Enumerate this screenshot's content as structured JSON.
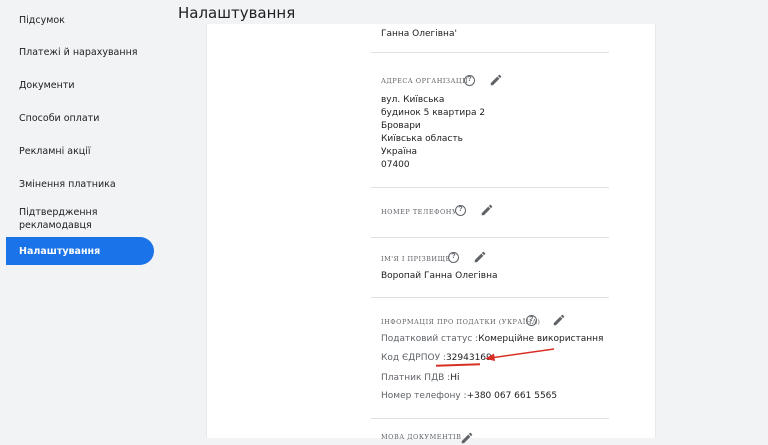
{
  "header": {
    "title": "Налаштування"
  },
  "sidebar": {
    "items": [
      {
        "label": "Підсумок"
      },
      {
        "label": "Платежі й нарахування"
      },
      {
        "label": "Документи"
      },
      {
        "label": "Способи оплати"
      },
      {
        "label": "Рекламні акції"
      },
      {
        "label": "Змінення платника"
      },
      {
        "label": "Підтвердження рекламодавця"
      },
      {
        "label": "Налаштування"
      }
    ],
    "active_index": 7
  },
  "settings": {
    "top_partial_name": "Ганна Олегівна'",
    "org_address": {
      "title": "Адреса організації",
      "lines": [
        "вул. Київська",
        "будинок 5 квартира 2",
        "Бровари",
        "Київська область",
        "Україна",
        "07400"
      ]
    },
    "phone": {
      "title": "Номер телефону"
    },
    "name": {
      "title": "Ім'я і прізвище",
      "value": "Воропай Ганна Олегівна"
    },
    "tax": {
      "title": "Інформація про податки (Україна)",
      "status_label": "Податковий статус :",
      "status_value": "Комерційне використання",
      "code_label": "Код ЄДРПОУ :",
      "code_value": "32943169",
      "vat_label": "Платник ПДВ :",
      "vat_value": "Ні",
      "phone_label": "Номер телефону :",
      "phone_value": "+380  067 661 5565"
    },
    "next_section_title": "Мова документів"
  },
  "colors": {
    "accent": "#1a73e8",
    "annotation": "#d93025"
  },
  "icons": {
    "help": "help-circle-icon",
    "edit": "pencil-icon"
  }
}
